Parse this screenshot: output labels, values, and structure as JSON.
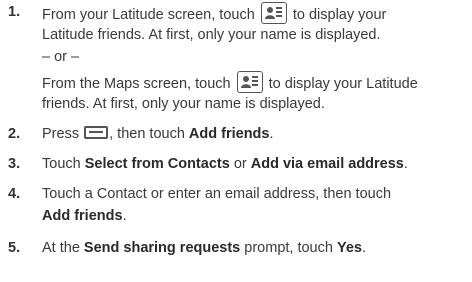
{
  "steps": [
    {
      "number": "1.",
      "line1_a": "From your Latitude screen, touch",
      "line1_b": "to display your",
      "line2": "Latitude friends. At first, only your name is displayed.",
      "or": "– or –",
      "line3_a": "From the Maps screen, touch",
      "line3_b": "to display your Latitude",
      "line4": "friends. At first, only your name is displayed."
    },
    {
      "number": "2.",
      "text_a": "Press",
      "text_b": ", then touch",
      "bold": "Add friends",
      "text_c": "."
    },
    {
      "number": "3.",
      "text_a": "Touch",
      "bold1": "Select from Contacts",
      "text_b": "or",
      "bold2": "Add via email address",
      "text_c": "."
    },
    {
      "number": "4.",
      "line1": "Touch a Contact or enter an email address, then touch",
      "bold": "Add friends",
      "text_c": "."
    },
    {
      "number": "5.",
      "text_a": "At the",
      "bold1": "Send sharing requests",
      "text_b": "prompt, touch",
      "bold2": "Yes",
      "text_c": "."
    }
  ],
  "icons": {
    "friends": "latitude-friends-icon",
    "menu": "menu-icon"
  },
  "colors": {
    "text": "#3a3a3a",
    "icon": "#555555"
  }
}
